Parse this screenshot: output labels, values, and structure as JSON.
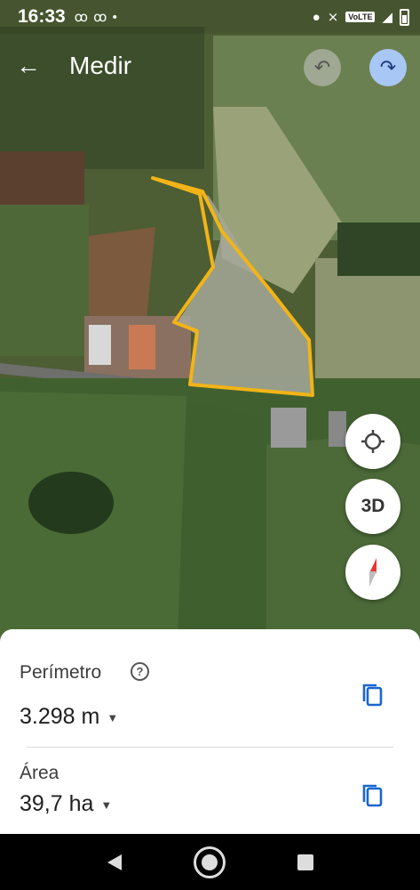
{
  "status_bar": {
    "time": "16:33",
    "left_icons": "ꝏ ꝏ •",
    "volte": "VoLTE",
    "icons": [
      "voicemail-icon",
      "voicemail-icon",
      "dot-icon",
      "dot-icon",
      "nfc-icon",
      "volte-icon",
      "signal-icon",
      "battery-icon"
    ]
  },
  "app_bar": {
    "back_glyph": "←",
    "title": "Medir",
    "undo_glyph": "↶",
    "redo_glyph": "↷"
  },
  "map_controls": {
    "three_d_label": "3D"
  },
  "measurements": {
    "perimeter_label": "Perímetro",
    "help_glyph": "?",
    "perimeter_value": "3.298 m",
    "area_label": "Área",
    "area_value": "39,7 ha",
    "caret_glyph": "▼"
  },
  "colors": {
    "polygon_outline": "#f2b417",
    "redo_button": "#a9c7f4",
    "copy_icon": "#1a66d1"
  }
}
